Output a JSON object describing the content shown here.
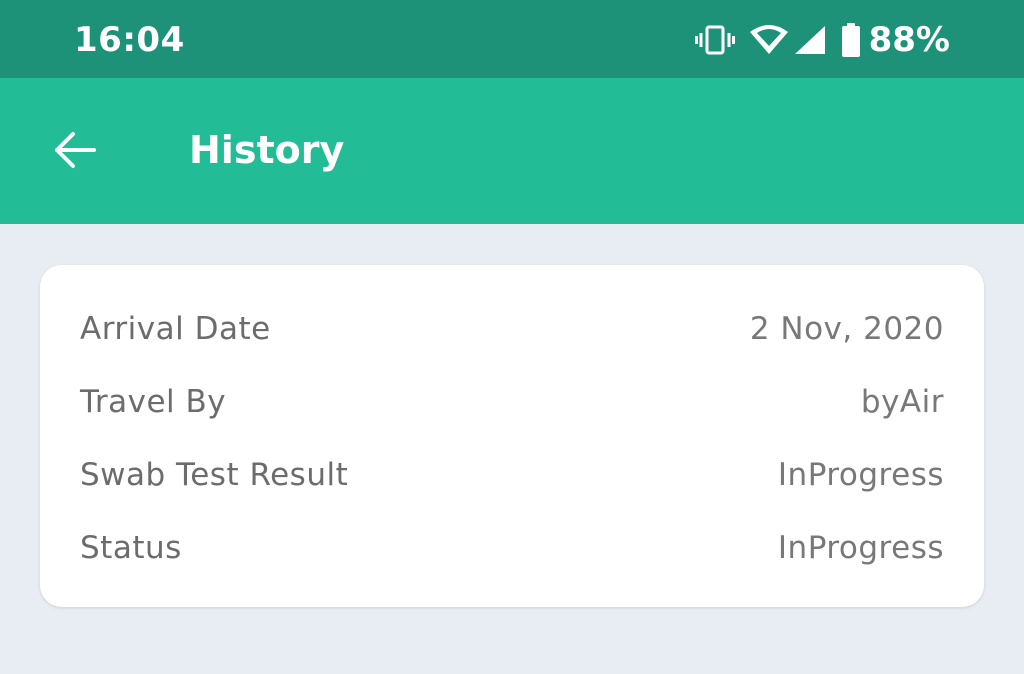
{
  "status_bar": {
    "time": "16:04",
    "battery_percent": "88%",
    "icons": [
      "vibrate-icon",
      "wifi-icon",
      "signal-icon",
      "battery-icon"
    ]
  },
  "app_bar": {
    "back_icon": "arrow-left-icon",
    "title": "History"
  },
  "history_card": {
    "rows": [
      {
        "label": "Arrival Date",
        "value": "2 Nov, 2020"
      },
      {
        "label": "Travel By",
        "value": "byAir"
      },
      {
        "label": "Swab Test Result",
        "value": "InProgress"
      },
      {
        "label": "Status",
        "value": "InProgress"
      }
    ]
  },
  "colors": {
    "status_bar": "#1e9279",
    "app_bar": "#22bd97",
    "background": "#e8edf4",
    "card": "#ffffff",
    "text_gray": "#6c6c6c"
  }
}
